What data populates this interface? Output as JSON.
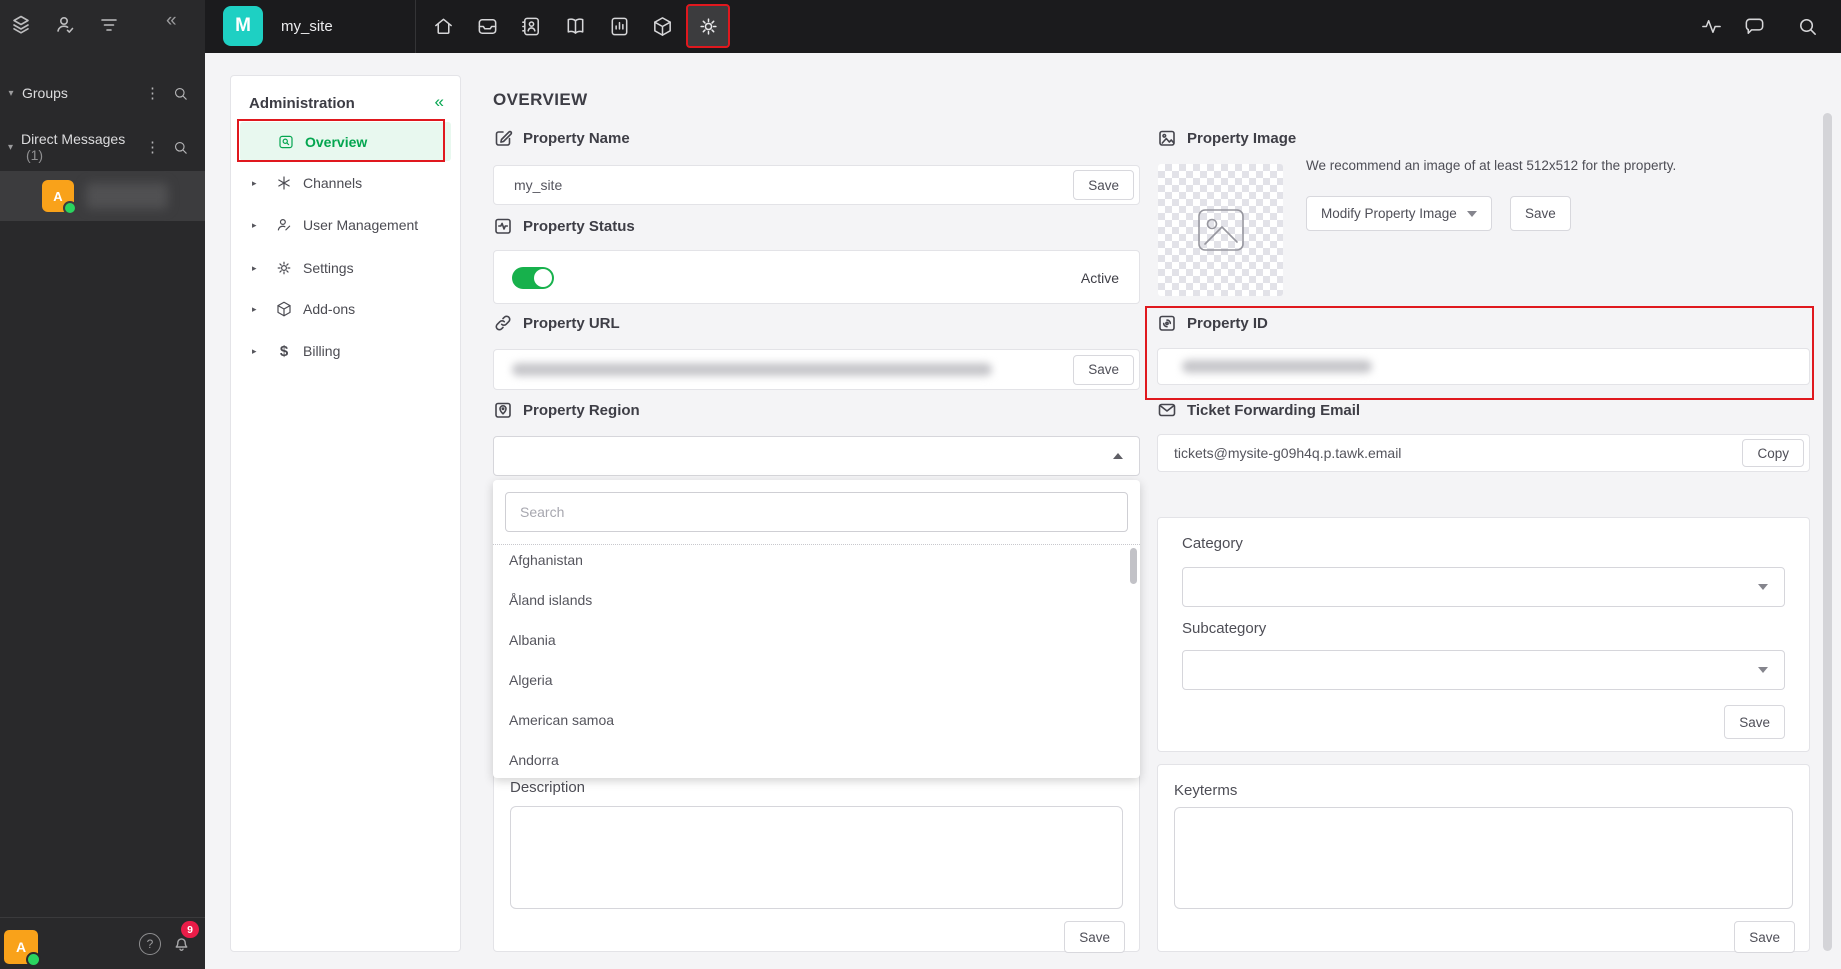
{
  "topbar": {
    "property_initial": "M",
    "property_name": "my_site"
  },
  "rail": {
    "groups_label": "Groups",
    "dm_label": "Direct Messages",
    "dm_count": "(1)",
    "dm_user_initial": "A",
    "profile_initial": "A",
    "notification_badge": "9",
    "help_glyph": "?"
  },
  "admin": {
    "title": "Administration",
    "collapse_glyph": "«",
    "items": [
      {
        "label": "Overview"
      },
      {
        "label": "Channels"
      },
      {
        "label": "User Management"
      },
      {
        "label": "Settings"
      },
      {
        "label": "Add-ons"
      },
      {
        "label": "Billing"
      }
    ]
  },
  "glyphs": {
    "kebab": "⋮",
    "chevron_down": "▾",
    "chevron_right": "▸",
    "dollar": "$"
  },
  "main": {
    "title": "OVERVIEW",
    "buttons": {
      "save": "Save",
      "copy": "Copy"
    },
    "property_name": {
      "label": "Property Name",
      "value": "my_site"
    },
    "property_status": {
      "label": "Property Status",
      "value": "Active"
    },
    "property_url": {
      "label": "Property URL"
    },
    "property_region": {
      "label": "Property Region",
      "search_placeholder": "Search",
      "countries": [
        "Afghanistan",
        "Åland islands",
        "Albania",
        "Algeria",
        "American samoa",
        "Andorra"
      ]
    },
    "description": {
      "label": "Description"
    },
    "property_image": {
      "label": "Property Image",
      "hint": "We recommend an image of at least 512x512 for the property.",
      "modify_button": "Modify Property Image"
    },
    "property_id": {
      "label": "Property ID"
    },
    "ticket_email": {
      "label": "Ticket Forwarding Email",
      "value": "tickets@mysite-g09h4q.p.tawk.email"
    },
    "category": {
      "label": "Category"
    },
    "subcategory": {
      "label": "Subcategory"
    },
    "keyterms": {
      "label": "Keyterms"
    }
  }
}
